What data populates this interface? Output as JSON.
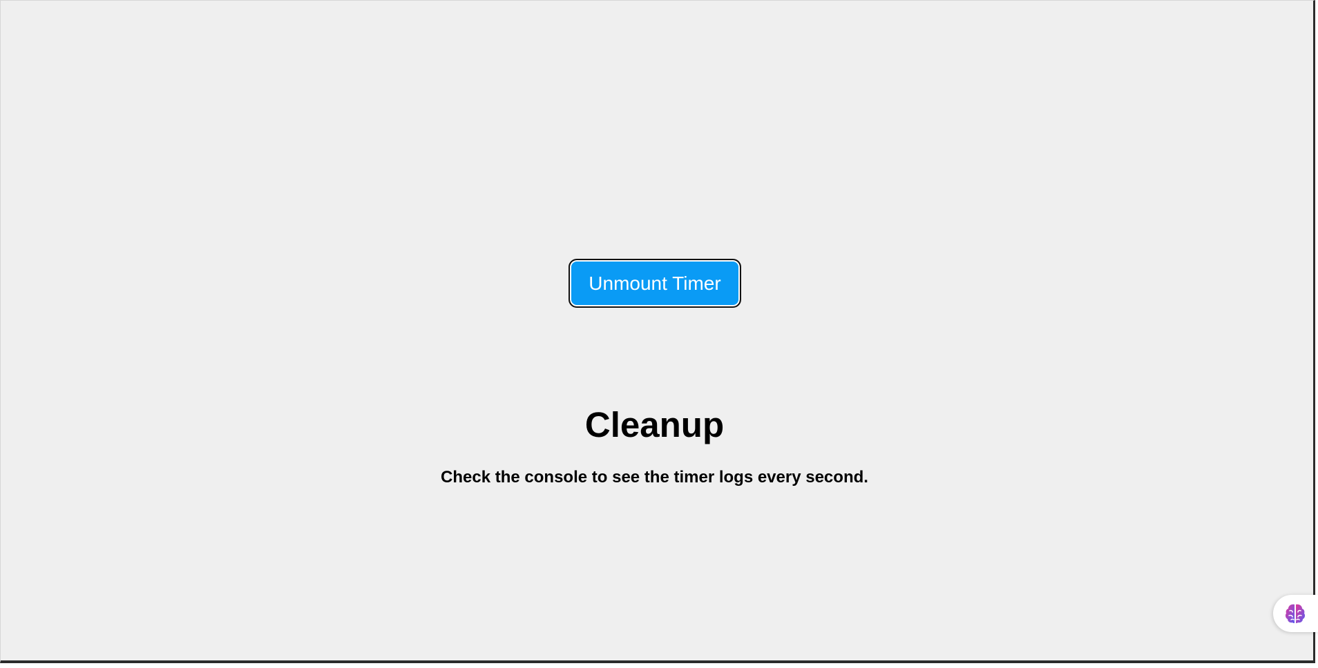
{
  "timer_control": {
    "button_label": "Unmount Timer"
  },
  "content": {
    "title": "Cleanup",
    "description": "Check the console to see the timer logs every second."
  },
  "assistant_widget": {
    "icon": "brain-icon",
    "colors": {
      "left": "#e0389a",
      "right": "#5b5bf0"
    }
  },
  "colors": {
    "background": "#efefef",
    "button": "#0a9bf5",
    "text": "#000000"
  }
}
